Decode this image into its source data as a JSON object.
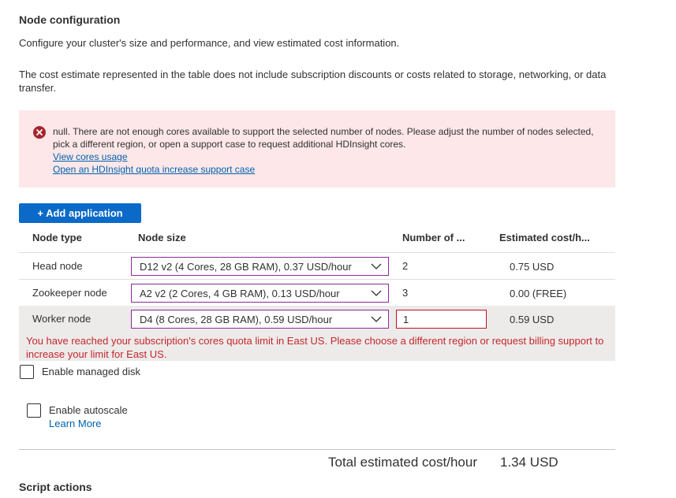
{
  "page": {
    "title": "Node configuration",
    "intro": "Configure your cluster's size and performance, and view estimated cost information.",
    "cost_note": "The cost estimate represented in the table does not include subscription discounts or costs related to storage, networking, or data transfer."
  },
  "error_banner": {
    "icon": "error-circle-icon",
    "message": "null. There are not enough cores available to support the selected number of nodes. Please adjust the number of nodes selected, pick a different region, or open a support case to request additional HDInsight cores.",
    "link1": "View cores usage",
    "link2": "Open an HDInsight quota increase support case"
  },
  "add_application_label": "+ Add application",
  "table": {
    "headers": [
      "Node type",
      "Node size",
      "Number of ...",
      "Estimated cost/h..."
    ],
    "rows": [
      {
        "type": "Head node",
        "size": "D12 v2 (4 Cores, 28 GB RAM), 0.37 USD/hour",
        "count": "2",
        "cost": "0.75 USD"
      },
      {
        "type": "Zookeeper node",
        "size": "A2 v2 (2 Cores, 4 GB RAM), 0.13 USD/hour",
        "count": "3",
        "cost": "0.00 (FREE)"
      },
      {
        "type": "Worker node",
        "size": "D4 (8 Cores, 28 GB RAM), 0.59 USD/hour",
        "count": "1",
        "cost": "0.59 USD"
      }
    ],
    "worker_error": "You have reached your subscription's cores quota limit in East US. Please choose a different region or request billing support to increase your limit for East US."
  },
  "options": {
    "managed_disk_label": "Enable managed disk",
    "autoscale_label": "Enable autoscale",
    "learn_more": "Learn More"
  },
  "total": {
    "label": "Total estimated cost/hour",
    "value": "1.34 USD"
  },
  "script_actions_title": "Script actions",
  "colors": {
    "accent": "#0b6ac8",
    "error_bg": "#fde7e9",
    "error_text": "#c4262e",
    "select_border": "#8a2a9a"
  }
}
